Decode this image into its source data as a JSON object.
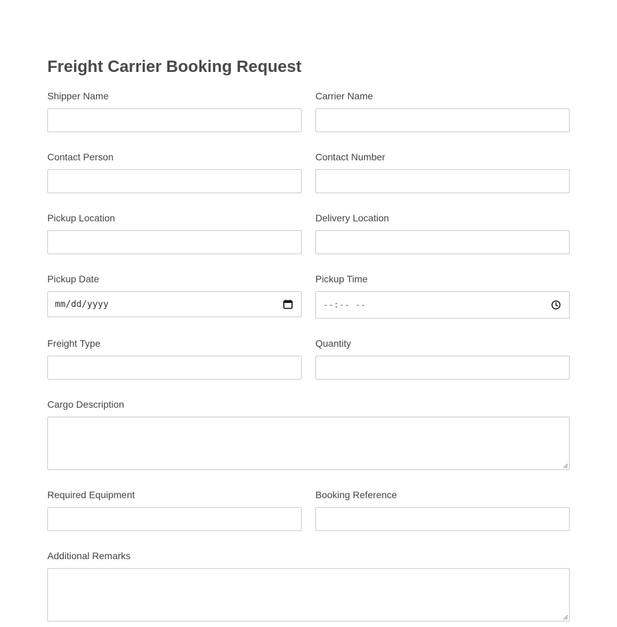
{
  "form": {
    "title": "Freight Carrier Booking Request",
    "fields": {
      "shipper_name": {
        "label": "Shipper Name",
        "value": ""
      },
      "carrier_name": {
        "label": "Carrier Name",
        "value": ""
      },
      "contact_person": {
        "label": "Contact Person",
        "value": ""
      },
      "contact_number": {
        "label": "Contact Number",
        "value": ""
      },
      "pickup_location": {
        "label": "Pickup Location",
        "value": ""
      },
      "delivery_location": {
        "label": "Delivery Location",
        "value": ""
      },
      "pickup_date": {
        "label": "Pickup Date",
        "placeholder": "mm/dd/yyyy",
        "icon": "calendar-icon"
      },
      "pickup_time": {
        "label": "Pickup Time",
        "placeholder": "--:-- --",
        "icon": "clock-icon"
      },
      "freight_type": {
        "label": "Freight Type",
        "value": ""
      },
      "quantity": {
        "label": "Quantity",
        "value": ""
      },
      "cargo_description": {
        "label": "Cargo Description",
        "value": ""
      },
      "required_equipment": {
        "label": "Required Equipment",
        "value": ""
      },
      "booking_reference": {
        "label": "Booking Reference",
        "value": ""
      },
      "additional_remarks": {
        "label": "Additional Remarks",
        "value": ""
      }
    }
  }
}
